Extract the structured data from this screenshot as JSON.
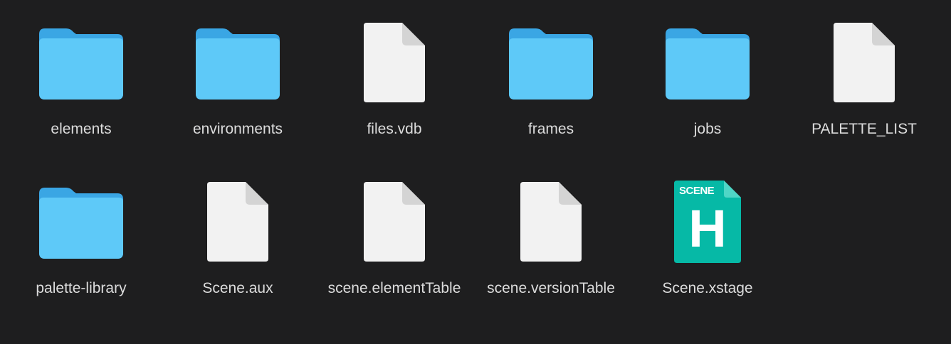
{
  "items": [
    {
      "kind": "folder",
      "name": "elements"
    },
    {
      "kind": "folder",
      "name": "environments"
    },
    {
      "kind": "document",
      "name": "files.vdb"
    },
    {
      "kind": "folder",
      "name": "frames"
    },
    {
      "kind": "folder",
      "name": "jobs"
    },
    {
      "kind": "document",
      "name": "PALETTE_LIST"
    },
    {
      "kind": "folder",
      "name": "palette-library"
    },
    {
      "kind": "document",
      "name": "Scene.aux"
    },
    {
      "kind": "document",
      "name": "scene.elementTable"
    },
    {
      "kind": "document",
      "name": "scene.versionTable"
    },
    {
      "kind": "app-document",
      "name": "Scene.xstage",
      "badge_text": "SCENE",
      "letter": "H"
    }
  ],
  "colors": {
    "background": "#1e1e1f",
    "label": "#dcdcdc",
    "folder_front": "#5ec9f8",
    "folder_back": "#3aa6e4",
    "doc_body": "#f2f2f2",
    "app_teal": "#06b9a6"
  }
}
